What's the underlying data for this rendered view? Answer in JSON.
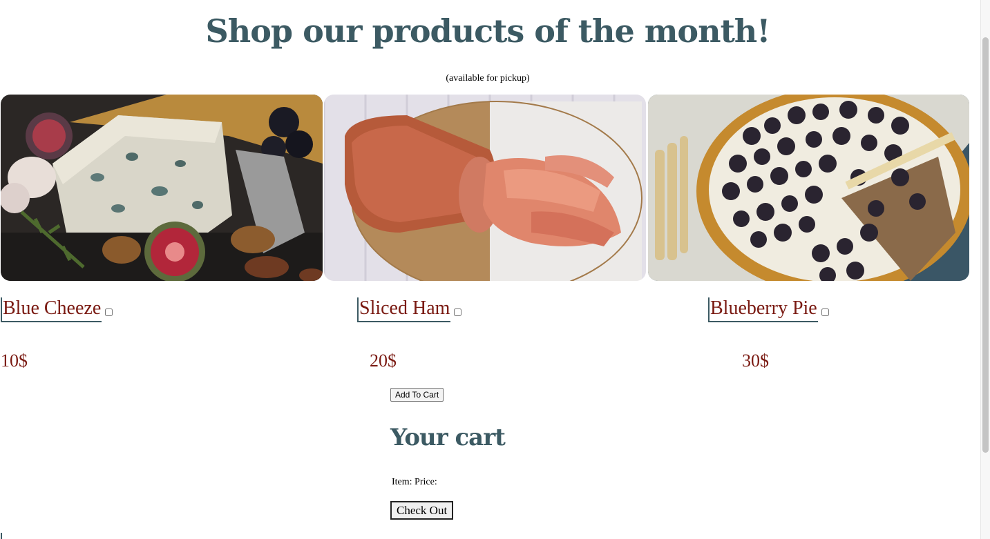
{
  "page": {
    "title": "Shop our products of the month!",
    "subtitle": "(available for pickup)"
  },
  "products": [
    {
      "name": "Blue Cheeze",
      "price": "10$",
      "image": "blue-cheese-photo",
      "checked": false
    },
    {
      "name": "Sliced Ham",
      "price": "20$",
      "image": "sliced-ham-photo",
      "checked": false
    },
    {
      "name": "Blueberry Pie",
      "price": "30$",
      "image": "blackberry-pie-photo",
      "checked": false
    }
  ],
  "actions": {
    "add_to_cart_label": "Add To Cart",
    "checkout_label": "Check Out"
  },
  "cart": {
    "title": "Your cart",
    "item_label": "Item:",
    "price_label": "Price:"
  },
  "colors": {
    "heading": "#3c5a63",
    "product_text": "#7a1a12"
  }
}
